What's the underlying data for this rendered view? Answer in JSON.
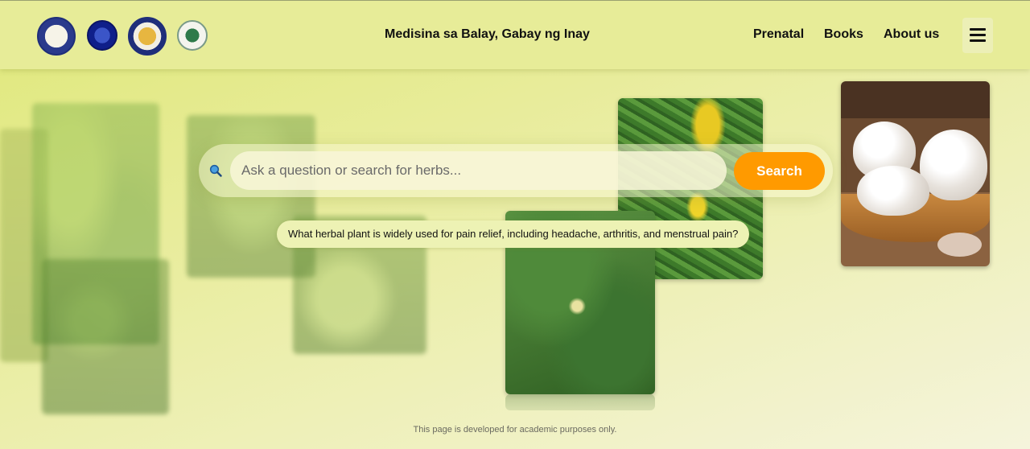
{
  "header": {
    "title": "Medisina sa Balay, Gabay ng Inay",
    "nav": [
      "Prenatal",
      "Books",
      "About us"
    ]
  },
  "search": {
    "placeholder": "Ask a question or search for herbs...",
    "button_label": "Search",
    "suggestion": "What herbal plant is widely used for pain relief, including headache, arthritis, and menstrual pain?"
  },
  "footer": {
    "note": "This page is developed for academic purposes only."
  },
  "colors": {
    "accent": "#ff9a00",
    "header_bg": "#e7ec98"
  },
  "icons": {
    "search": "magnifier-icon",
    "menu": "hamburger-icon"
  }
}
